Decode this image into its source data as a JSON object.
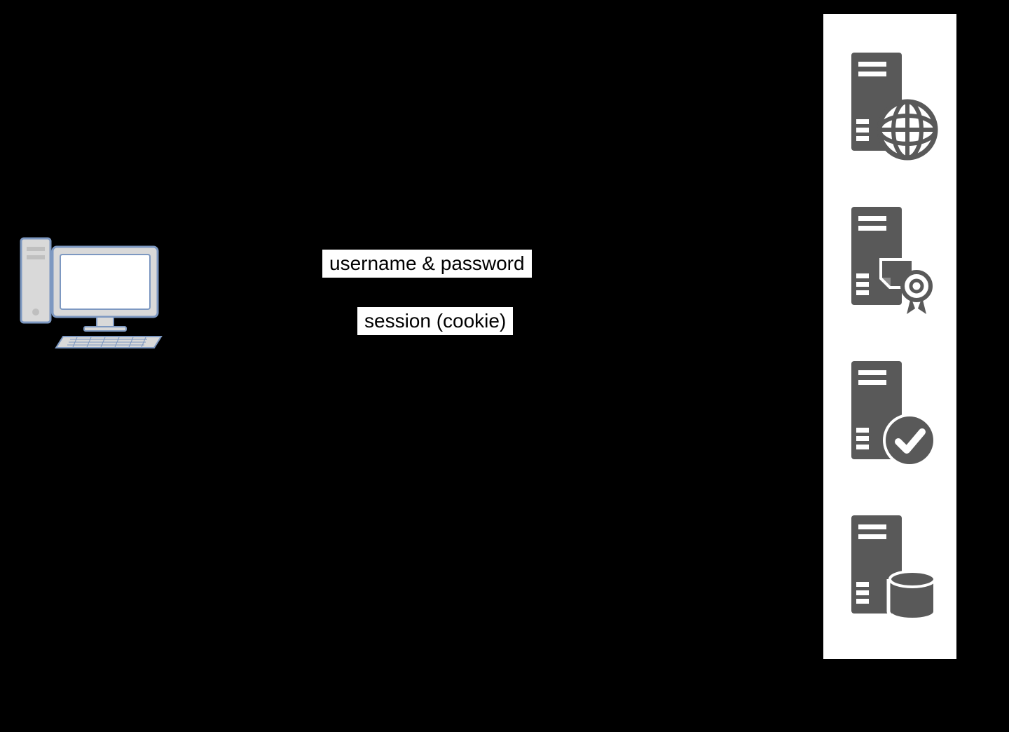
{
  "labels": {
    "request": "username & password",
    "response": "session (cookie)"
  },
  "icons": {
    "client": "desktop-computer",
    "servers": [
      "web-server",
      "cert-server",
      "auth-server",
      "db-server"
    ]
  },
  "colors": {
    "server_gray": "#595959",
    "client_blue": "#7d98c1",
    "client_light": "#e6ecf5"
  }
}
